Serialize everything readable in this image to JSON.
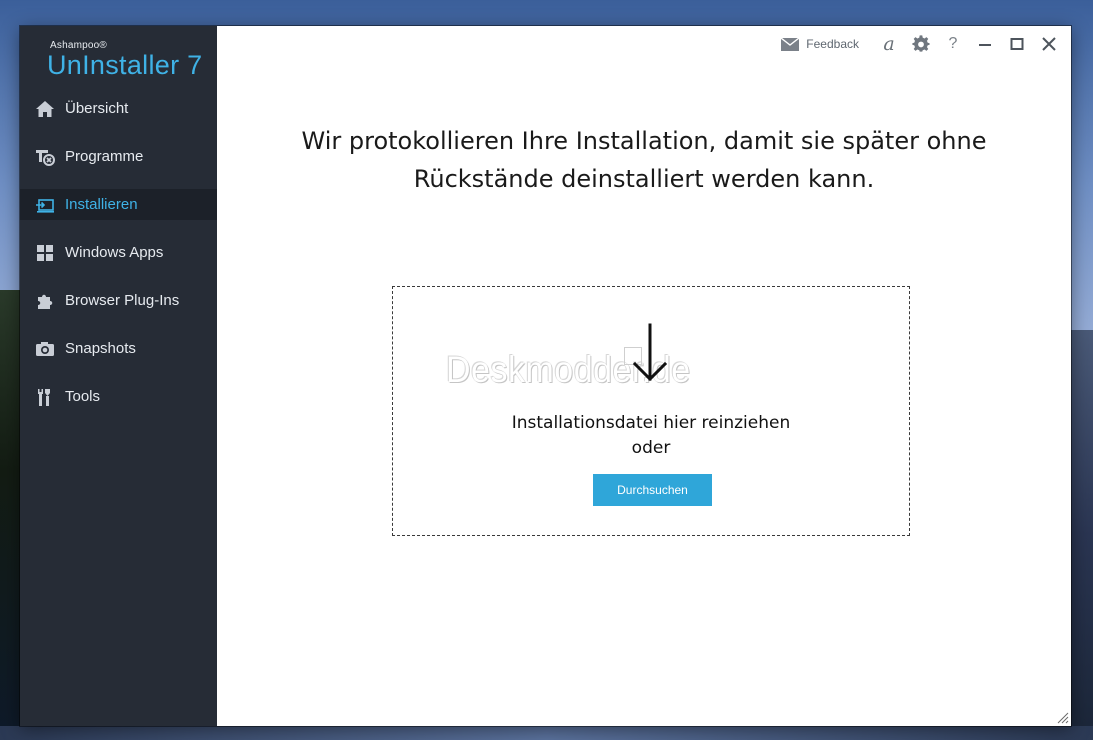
{
  "app": {
    "brand_small": "Ashampoo®",
    "brand_name": "UnInstaller 7"
  },
  "sidebar": {
    "items": [
      {
        "label": "Übersicht",
        "icon": "home-icon",
        "active": false
      },
      {
        "label": "Programme",
        "icon": "programs-icon",
        "active": false
      },
      {
        "label": "Installieren",
        "icon": "install-icon",
        "active": true
      },
      {
        "label": "Windows Apps",
        "icon": "windows-apps-icon",
        "active": false
      },
      {
        "label": "Browser Plug-Ins",
        "icon": "puzzle-icon",
        "active": false
      },
      {
        "label": "Snapshots",
        "icon": "camera-icon",
        "active": false
      },
      {
        "label": "Tools",
        "icon": "tools-icon",
        "active": false
      }
    ]
  },
  "titlebar": {
    "feedback_label": "Feedback",
    "account_glyph": "a",
    "help_glyph": "?"
  },
  "main": {
    "headline_line1": "Wir protokollieren Ihre Installation, damit sie später ohne",
    "headline_line2": "Rückstände deinstalliert werden kann.",
    "dropzone": {
      "watermark": "Deskmodder.de",
      "text_line1": "Installationsdatei hier reinziehen",
      "text_line2": "oder",
      "browse_label": "Durchsuchen"
    }
  },
  "colors": {
    "accent": "#3fb2e6",
    "sidebar_bg": "#262c36",
    "button_bg": "#2fa6d9"
  }
}
